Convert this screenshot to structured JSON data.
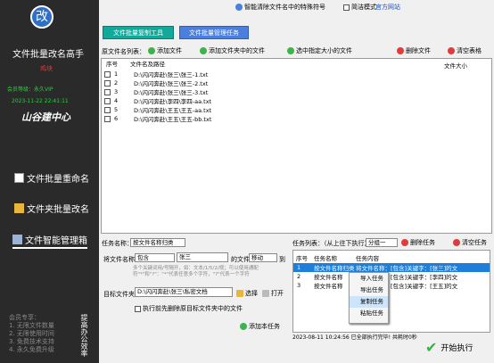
{
  "sidebar": {
    "logo_glyph": "改",
    "app_title": "文件批量改名高手",
    "user": "鸡块",
    "level": "会员等级：永久VIP",
    "expire": "2023-11-22 22:41:11",
    "brand": "山谷建中心",
    "nav": [
      "文件批量重命名",
      "文件夹批量改名",
      "文件智能管理箱"
    ],
    "member_text": [
      "会员专享：",
      "1. 无限文件数量",
      "2. 无限使用时间",
      "3. 免费技术支持",
      "4. 永久免费升级"
    ],
    "vertical_text": "提高办公效率"
  },
  "topbar": {
    "clear_special": "智能清除文件名中的特殊符号",
    "simple_mode": "简洁模式",
    "official_site": "官方网站"
  },
  "buttons": {
    "tool": "文件批量复制工具",
    "task": "文件批量管理任务"
  },
  "toolbar": {
    "list_label": "原文件名列表：",
    "add_file": "添加文件",
    "add_folder": "添加文件夹中的文件",
    "select_size": "选中指定大小的文件",
    "delete_file": "删除文件",
    "clear_table": "清空表格"
  },
  "file_table": {
    "headers": [
      "序号",
      "文件名及路径",
      "文件大小"
    ],
    "rows": [
      {
        "no": "1",
        "path": "D:\\闪闪奔赴\\张三\\张三-1.txt"
      },
      {
        "no": "2",
        "path": "D:\\闪闪奔赴\\张三\\张三-2.txt"
      },
      {
        "no": "3",
        "path": "D:\\闪闪奔赴\\张三\\张三-3.txt"
      },
      {
        "no": "4",
        "path": "D:\\闪闪奔赴\\李四\\李四-aa.txt"
      },
      {
        "no": "5",
        "path": "D:\\闪闪奔赴\\王五\\王五-aa.txt"
      },
      {
        "no": "6",
        "path": "D:\\闪闪奔赴\\王五\\王五-bb.txt"
      }
    ]
  },
  "task_form": {
    "task_name_label": "任务名称：",
    "task_name_value": "按文件名称归类",
    "rule_label": "将文件名称",
    "rule_op": "包含",
    "rule_value": "张三",
    "rule_mid": "的文件",
    "rule_action": "移动",
    "rule_to": "到",
    "hint": "多个关键词用/号隔开，如：文本/1/5/2/视；可以使用通配符\"*\"和\"?\"：\"*\"代表任意多个字符，\"?\"代表一个字符",
    "target_label": "目标文件夹：",
    "target_value": "D:\\闪闪奔赴\\张三\\私密文档",
    "choose": "选择",
    "open": "打开",
    "delete_before": "执行前先删除原目标文件夹中的文件",
    "add_task": "添加本任务"
  },
  "task_list": {
    "label": "任务列表：（从上往下执行）",
    "group": "分组一",
    "delete_task": "删除任务",
    "clear_task": "清空任务",
    "headers": [
      "序号",
      "任务名称",
      "任务内容"
    ],
    "rows": [
      {
        "no": "1",
        "name": "按文件名称归类",
        "content": "将文件名称：[包含]关键字：[张三]的文"
      },
      {
        "no": "2",
        "name": "按文件名称",
        "content": "将文件名称：[包含]关键字：[李四]的文"
      },
      {
        "no": "3",
        "name": "按文件名称",
        "content": "将文件名称：[包含]关键字：[王五]的文"
      }
    ]
  },
  "context_menu": [
    "导入任务",
    "导出任务",
    "复制任务",
    "粘贴任务"
  ],
  "status": {
    "text": "2023-08-11 10:24:56 已全部执行完毕! 共耗时0秒"
  },
  "execute": "开始执行",
  "colors": {
    "sidebar": "#2a2a2a",
    "teal": "#12a89a",
    "blue": "#4a7fe0",
    "select": "#1e7fd8"
  }
}
